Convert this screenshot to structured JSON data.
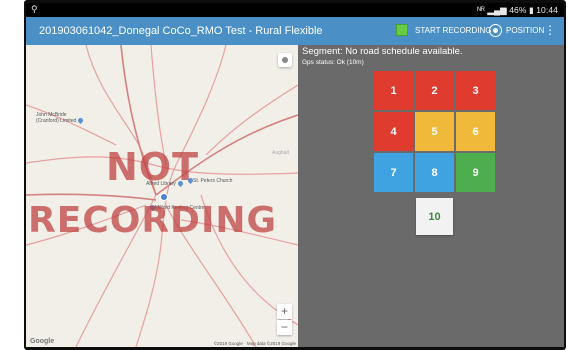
{
  "status_bar": {
    "location_glyph": "⚲",
    "right_text": "ᴺᴿ ▂▄▆ 46% ▮ 10:44"
  },
  "app_bar": {
    "title": "201903061042_Donegal CoCo_RMO Test - Rural Flexible",
    "start_recording_label": "START RECORDING",
    "position_label": "POSITION",
    "more_glyph": "⋮",
    "colors": {
      "bar": "#4a90c6",
      "record_square": "#66cc44"
    }
  },
  "map": {
    "overlay_line1": "NOT",
    "overlay_line2": "RECORDING",
    "pois": [
      {
        "label": "John McBride\n(Cranford) Limited",
        "icon": "map-pin-icon"
      },
      {
        "label": "St. Peters Church",
        "icon": "map-pin-icon"
      },
      {
        "label": "Alfred Library",
        "icon": "map-pin-icon"
      },
      {
        "label": "Milford Keeling Centre",
        "icon": "map-pin-icon"
      }
    ],
    "place_label": "Aughalt",
    "google_logo": "Google",
    "copyright": "©2019 Google · Map data ©2019 Google",
    "zoom_in": "+",
    "zoom_out": "−"
  },
  "panel": {
    "segment_text": "Segment: No road schedule available.",
    "gps_text": "Gps status: Ok (10m)",
    "buttons": [
      {
        "label": "1",
        "color": "#e03b2f"
      },
      {
        "label": "2",
        "color": "#e03b2f"
      },
      {
        "label": "3",
        "color": "#e03b2f"
      },
      {
        "label": "4",
        "color": "#e03b2f"
      },
      {
        "label": "5",
        "color": "#f0b93a"
      },
      {
        "label": "6",
        "color": "#f0b93a"
      },
      {
        "label": "7",
        "color": "#3ea3e0"
      },
      {
        "label": "8",
        "color": "#3ea3e0"
      },
      {
        "label": "9",
        "color": "#4cae4c"
      }
    ],
    "button_10": {
      "label": "10",
      "color": "#f2f2f2",
      "text_color": "#3d8a3d"
    }
  }
}
